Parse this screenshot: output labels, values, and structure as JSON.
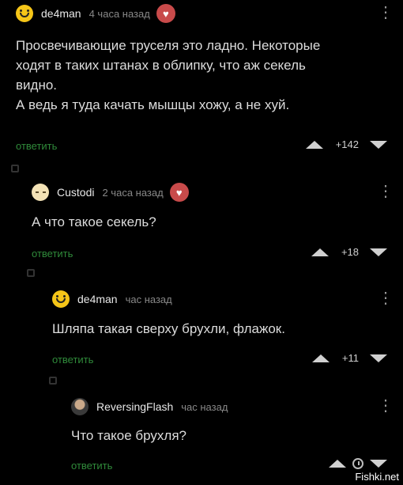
{
  "comments": [
    {
      "user": "de4man",
      "time": "4 часа назад",
      "lines": [
        "Просвечивающие труселя это ладно. Некоторые",
        "ходят в таких штанах в облипку, что аж секель",
        "видно.",
        "А ведь я туда качать мышцы хожу, а не хуй."
      ],
      "reply": "ответить",
      "score": "+142"
    },
    {
      "user": "Custodi",
      "time": "2 часа назад",
      "lines": [
        "А что такое секель?"
      ],
      "reply": "ответить",
      "score": "+18"
    },
    {
      "user": "de4man",
      "time": "час назад",
      "lines": [
        "Шляпа такая сверху брухли, флажок."
      ],
      "reply": "ответить",
      "score": "+11"
    },
    {
      "user": "ReversingFlash",
      "time": "час назад",
      "lines": [
        "Что такое брухля?"
      ],
      "reply": "ответить",
      "score": ""
    }
  ],
  "icons": {
    "menu": "vertical-ellipsis",
    "upvote": "triangle-up",
    "downvote": "triangle-down",
    "pending": "clock"
  },
  "colors": {
    "reply": "#2f8a3a",
    "background": "#000000"
  },
  "watermark": "Fishki.net"
}
